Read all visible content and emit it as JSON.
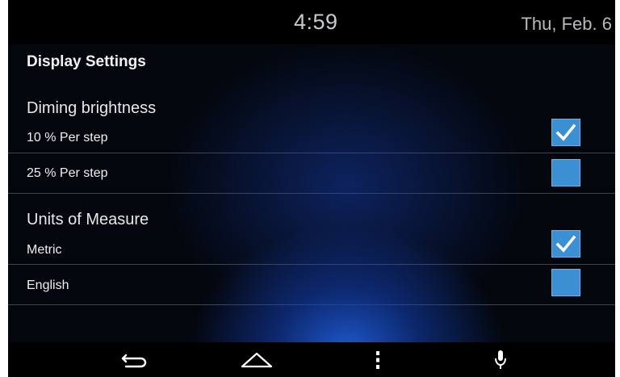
{
  "status_bar": {
    "time": "4:59",
    "date": "Thu, Feb. 6"
  },
  "page": {
    "title": "Display Settings"
  },
  "sections": [
    {
      "label": "Diming brightness",
      "options": [
        {
          "label": "10 % Per step",
          "checked": true
        },
        {
          "label": "25 % Per step",
          "checked": false
        }
      ]
    },
    {
      "label": "Units of Measure",
      "options": [
        {
          "label": "Metric",
          "checked": true
        },
        {
          "label": "English",
          "checked": false
        }
      ]
    }
  ],
  "nav": {
    "items": [
      {
        "icon": "back-icon"
      },
      {
        "icon": "home-icon"
      },
      {
        "icon": "menu-icon"
      },
      {
        "icon": "microphone-icon"
      }
    ]
  },
  "colors": {
    "checkbox": "#3b8fd3",
    "background": "#03060d",
    "accent_glow": "#1e5ad2"
  }
}
